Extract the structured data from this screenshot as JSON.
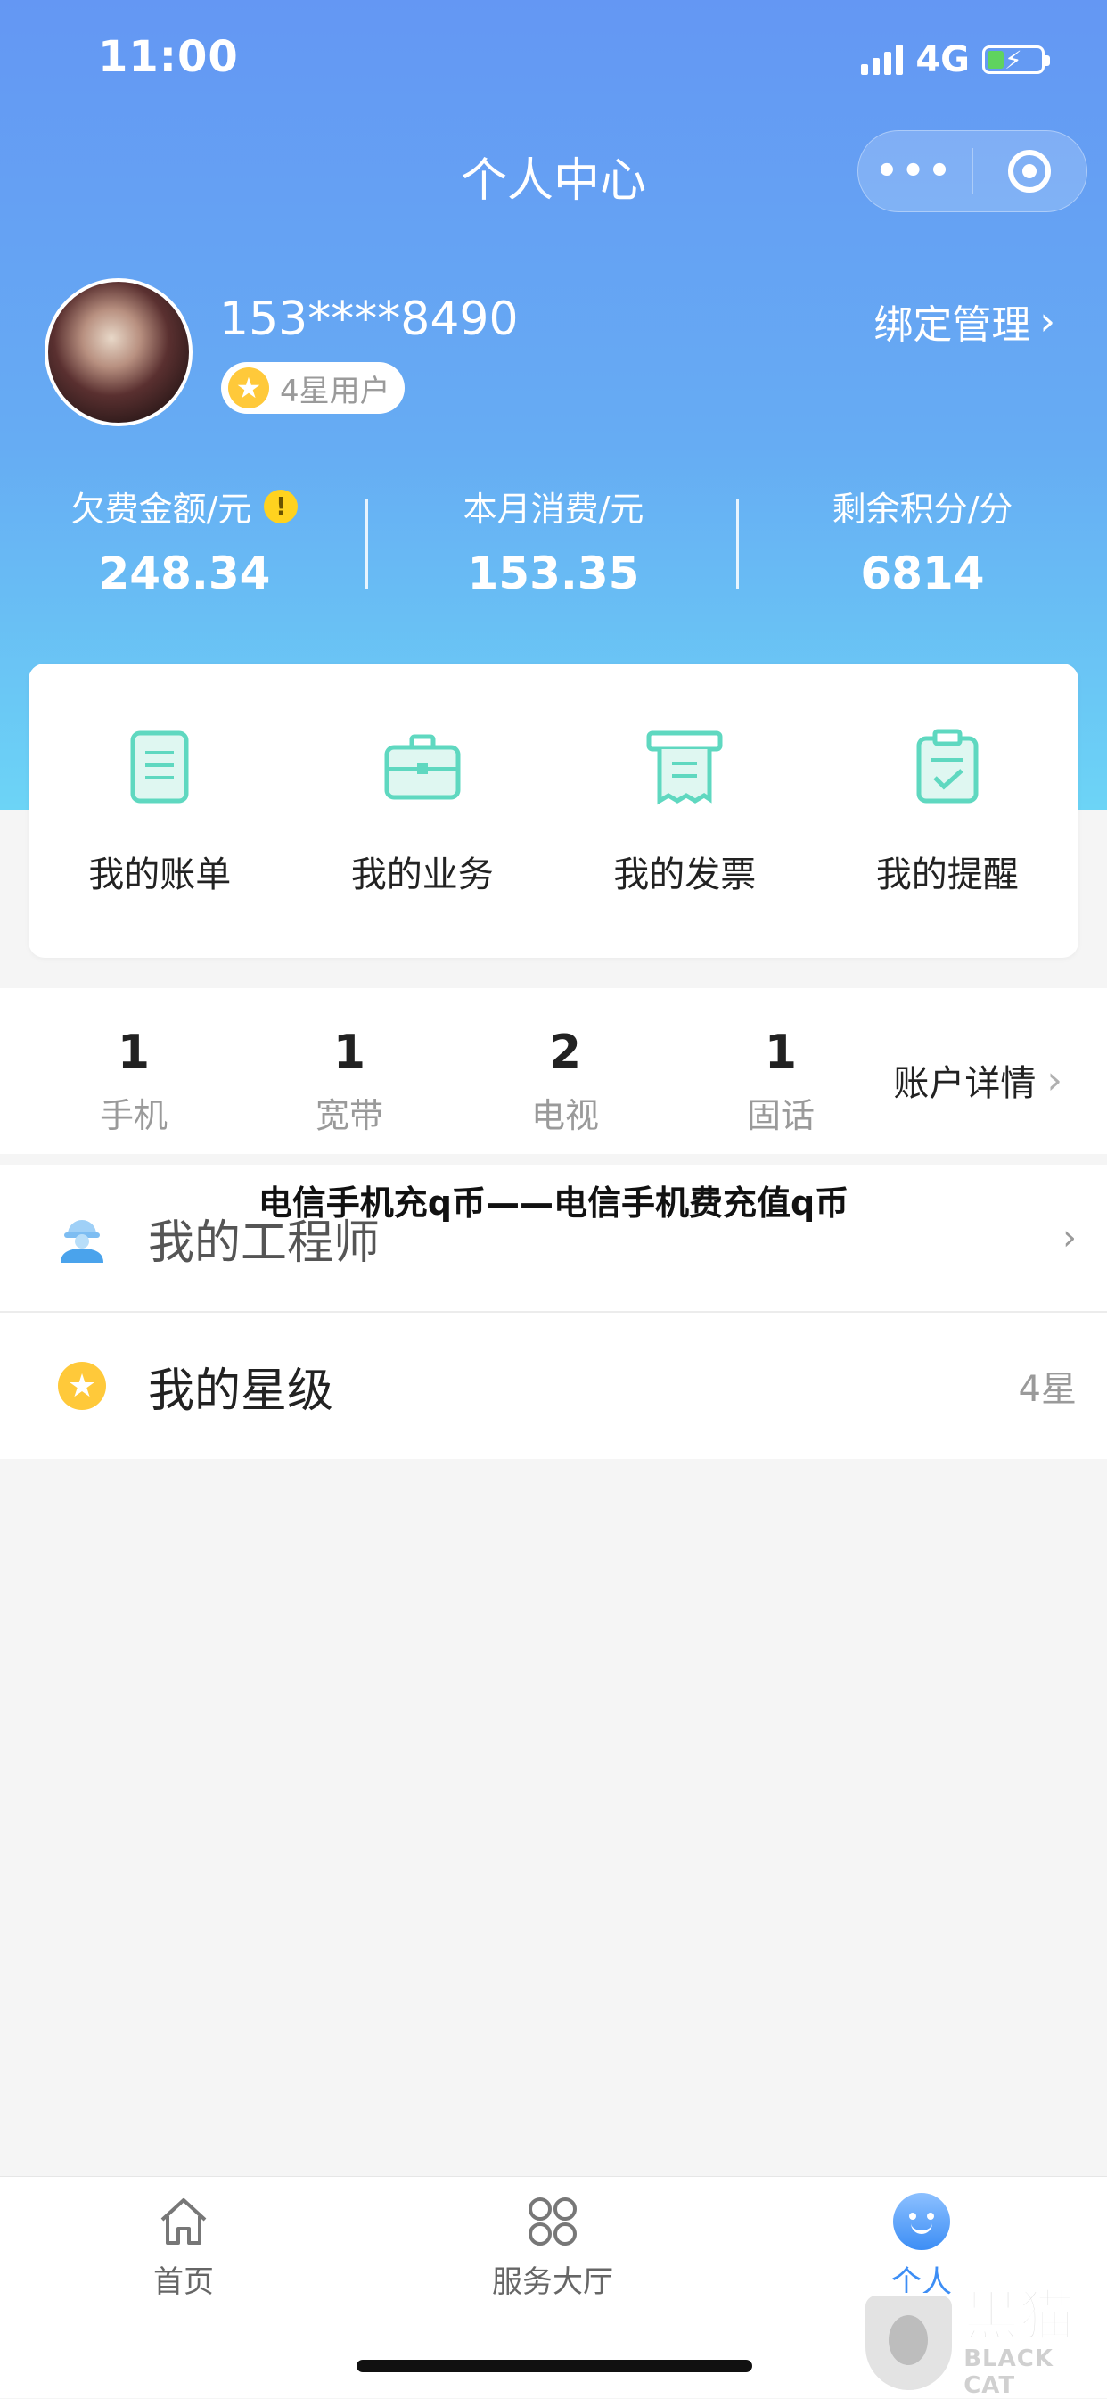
{
  "status_bar": {
    "time": "11:00",
    "network": "4G"
  },
  "header": {
    "title": "个人中心"
  },
  "profile": {
    "phone": "153****8490",
    "star_label": "4星用户",
    "bind_label": "绑定管理"
  },
  "stats": [
    {
      "label": "欠费金额/元",
      "value": "248.34"
    },
    {
      "label": "本月消费/元",
      "value": "153.35"
    },
    {
      "label": "剩余积分/分",
      "value": "6814"
    }
  ],
  "quick_actions": [
    {
      "label": "我的账单",
      "icon": "bill-icon"
    },
    {
      "label": "我的业务",
      "icon": "briefcase-icon"
    },
    {
      "label": "我的发票",
      "icon": "invoice-icon"
    },
    {
      "label": "我的提醒",
      "icon": "reminder-icon"
    }
  ],
  "services": [
    {
      "count": "1",
      "label": "手机"
    },
    {
      "count": "1",
      "label": "宽带"
    },
    {
      "count": "2",
      "label": "电视"
    },
    {
      "count": "1",
      "label": "固话"
    }
  ],
  "account_detail_label": "账户详情",
  "engineer_row": {
    "label": "我的工程师"
  },
  "star_row": {
    "label": "我的星级",
    "value": "4星"
  },
  "overlay_caption": "电信手机充q币——电信手机费充值q币",
  "tabbar": [
    {
      "label": "首页"
    },
    {
      "label": "服务大厅"
    },
    {
      "label": "个人"
    }
  ],
  "watermark": {
    "cn": "黑猫",
    "en": "BLACK CAT"
  },
  "colors": {
    "accent": "#3d8ef5",
    "icon_teal": "#5fd8c0",
    "star": "#ffc93a"
  }
}
